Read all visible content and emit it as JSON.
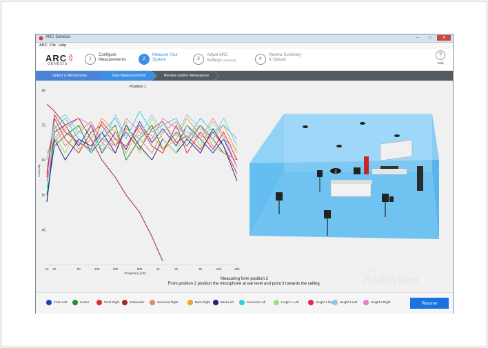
{
  "window": {
    "title": "ARC Genesis",
    "controls": {
      "minimize": "–",
      "maximize": "□",
      "close": "✕"
    }
  },
  "menu": [
    "ARC",
    "File",
    "Help"
  ],
  "logo": {
    "main": "ARC",
    "sub": "GENESIS"
  },
  "steps": [
    {
      "num": "1",
      "line1": "Configure",
      "line2": "Measurements",
      "line3": ""
    },
    {
      "num": "2",
      "line1": "Measure Your",
      "line2": "System",
      "line3": ""
    },
    {
      "num": "3",
      "line1": "Adjust ARC",
      "line2": "Settings",
      "line3": "(optional)"
    },
    {
      "num": "4",
      "line1": "Review Summary",
      "line2": "& Upload",
      "line3": ""
    }
  ],
  "help": {
    "icon": "?",
    "label": "Help"
  },
  "subtabs": [
    "Select a Microphone",
    "Take Measurements",
    "Review and/or Remeasure"
  ],
  "chart": {
    "title": "Position 1"
  },
  "chart_data": {
    "type": "line",
    "title": "Position 1",
    "xlabel": "Frequency (Hz)",
    "ylabel": "Level (dB)",
    "x_scale": "log",
    "xlim": [
      15,
      20000
    ],
    "ylim": [
      30,
      80
    ],
    "x_ticks": [
      "15",
      "20",
      "50",
      "100",
      "200",
      "500",
      "1k",
      "2k",
      "5k",
      "10k",
      "20k"
    ],
    "y_ticks": [
      "80",
      "70",
      "60",
      "50",
      "40"
    ],
    "grid": false,
    "x": [
      15,
      20,
      30,
      50,
      80,
      120,
      200,
      300,
      500,
      800,
      1200,
      2000,
      3000,
      5000,
      8000,
      12000,
      20000
    ],
    "series": [
      {
        "name": "Front Left",
        "color": "#1a3fbf",
        "values": [
          48,
          68,
          70,
          64,
          70,
          62,
          68,
          63,
          71,
          65,
          69,
          64,
          70,
          66,
          62,
          66,
          58
        ]
      },
      {
        "name": "Center",
        "color": "#1e8f3a",
        "values": [
          50,
          64,
          67,
          70,
          62,
          66,
          70,
          60,
          66,
          70,
          63,
          68,
          64,
          70,
          66,
          62,
          60
        ]
      },
      {
        "name": "Front Right",
        "color": "#d62f2f",
        "values": [
          55,
          72,
          66,
          62,
          68,
          70,
          64,
          68,
          63,
          69,
          71,
          65,
          67,
          63,
          68,
          64,
          56
        ]
      },
      {
        "name": "Subwoofer",
        "color": "#a52832",
        "values": [
          76,
          74,
          70,
          72,
          66,
          60,
          55,
          50,
          45,
          38,
          31,
          null,
          null,
          null,
          null,
          null,
          null
        ]
      },
      {
        "name": "Surround Right",
        "color": "#e08a6a",
        "values": [
          60,
          70,
          64,
          68,
          71,
          65,
          62,
          69,
          66,
          62,
          68,
          71,
          66,
          70,
          64,
          62,
          60
        ]
      },
      {
        "name": "Back Right",
        "color": "#f2a52d",
        "values": [
          62,
          66,
          70,
          63,
          66,
          72,
          68,
          62,
          69,
          67,
          63,
          66,
          72,
          67,
          66,
          70,
          62
        ]
      },
      {
        "name": "Back Left",
        "color": "#23237e",
        "values": [
          48,
          66,
          60,
          66,
          64,
          68,
          62,
          70,
          64,
          60,
          66,
          62,
          66,
          62,
          69,
          64,
          54
        ]
      },
      {
        "name": "Surround Left",
        "color": "#2fd0e0",
        "values": [
          52,
          69,
          72,
          66,
          62,
          68,
          72,
          66,
          74,
          68,
          70,
          72,
          66,
          72,
          68,
          70,
          66
        ]
      },
      {
        "name": "Height 1 Left",
        "color": "#9be070",
        "values": [
          58,
          67,
          62,
          70,
          68,
          63,
          66,
          71,
          62,
          72,
          66,
          62,
          70,
          64,
          71,
          66,
          63
        ]
      },
      {
        "name": "Height 1 Right",
        "color": "#e0284a",
        "values": [
          56,
          73,
          68,
          65,
          63,
          71,
          66,
          64,
          70,
          64,
          62,
          70,
          62,
          68,
          63,
          68,
          60
        ]
      },
      {
        "name": "Height 2 Left",
        "color": "#8dc6ee",
        "values": [
          60,
          71,
          73,
          68,
          66,
          64,
          73,
          67,
          67,
          73,
          68,
          67,
          73,
          69,
          66,
          72,
          64
        ]
      },
      {
        "name": "Height 2 Right",
        "color": "#e87fc4",
        "values": [
          54,
          65,
          69,
          72,
          70,
          66,
          64,
          72,
          68,
          66,
          72,
          69,
          68,
          66,
          72,
          67,
          58
        ]
      }
    ]
  },
  "instructions": {
    "line1": "Measuring form position 2",
    "line2": "From position 2 position the microphone at ear level and point it towards the ceiling."
  },
  "legend": [
    {
      "label": "Front Left",
      "color": "#1a3fbf"
    },
    {
      "label": "Center",
      "color": "#1e8f3a"
    },
    {
      "label": "Front Right",
      "color": "#d62f2f"
    },
    {
      "label": "Subwoofer",
      "color": "#a52832"
    },
    {
      "label": "Surround Right",
      "color": "#e08a6a"
    },
    {
      "label": "Back Right",
      "color": "#f2a52d"
    },
    {
      "label": "Back Left",
      "color": "#23237e"
    },
    {
      "label": "Surround Left",
      "color": "#2fd0e0"
    },
    {
      "label": "Height 1 Left",
      "color": "#9be070"
    },
    {
      "label": "Height 1 Right",
      "color": "#e0284a"
    },
    {
      "label": "Height 2 Left",
      "color": "#8dc6ee"
    },
    {
      "label": "Height 2 Right",
      "color": "#e87fc4"
    }
  ],
  "resume_label": "Resume",
  "room": {
    "position_badge": "2"
  },
  "watermark": {
    "main": "AudioVideo",
    "small": "salon"
  },
  "colors": {
    "accent": "#3d8fe6",
    "button": "#1a73e0",
    "subtab_active": "#3d8fe6",
    "subtab_bar": "#555a61",
    "room": "#5ab7ef"
  }
}
